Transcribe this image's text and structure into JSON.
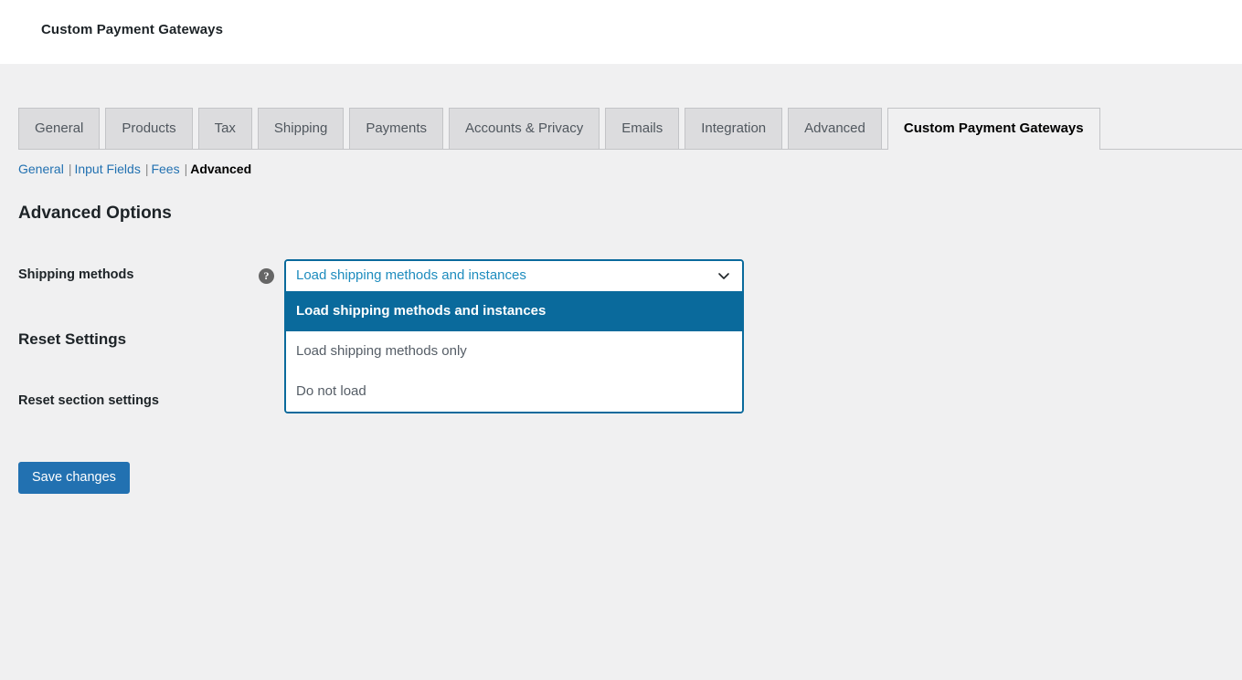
{
  "header": {
    "page_heading": "Custom Payment Gateways"
  },
  "tabs": [
    {
      "label": "General",
      "active": false
    },
    {
      "label": "Products",
      "active": false
    },
    {
      "label": "Tax",
      "active": false
    },
    {
      "label": "Shipping",
      "active": false
    },
    {
      "label": "Payments",
      "active": false
    },
    {
      "label": "Accounts & Privacy",
      "active": false
    },
    {
      "label": "Emails",
      "active": false
    },
    {
      "label": "Integration",
      "active": false
    },
    {
      "label": "Advanced",
      "active": false
    },
    {
      "label": "Custom Payment Gateways",
      "active": true
    }
  ],
  "subnav": {
    "items": [
      {
        "label": "General",
        "current": false
      },
      {
        "label": "Input Fields",
        "current": false
      },
      {
        "label": "Fees",
        "current": false
      },
      {
        "label": "Advanced",
        "current": true
      }
    ],
    "separator": "|"
  },
  "sections": [
    {
      "title": "Advanced Options",
      "fields": [
        {
          "label": "Shipping methods",
          "help_icon": "help-question-icon",
          "help_glyph": "?",
          "control": {
            "type": "select",
            "state": "open",
            "selected_value": "Load shipping methods and instances",
            "chevron_icon": "chevron-down-icon",
            "options": [
              "Load shipping methods and instances",
              "Load shipping methods only",
              "Do not load"
            ]
          }
        }
      ]
    },
    {
      "title": "Reset Settings",
      "fields": [
        {
          "label": "Reset section settings"
        }
      ]
    }
  ],
  "actions": {
    "save_label": "Save changes"
  },
  "colors": {
    "page_background": "#f0f0f1",
    "header_background": "#ffffff",
    "tab_inactive_background": "#dcdcde",
    "tab_border": "#c3c4c7",
    "link_blue": "#2271b1",
    "select_border_blue": "#0a6a9c",
    "select_highlight_blue": "#0a6a9c",
    "select_display_text_blue": "#1e8cbe",
    "button_blue": "#2271b1",
    "help_icon_gray": "#666666",
    "text_dark": "#1d2327",
    "text_muted": "#50575e"
  }
}
